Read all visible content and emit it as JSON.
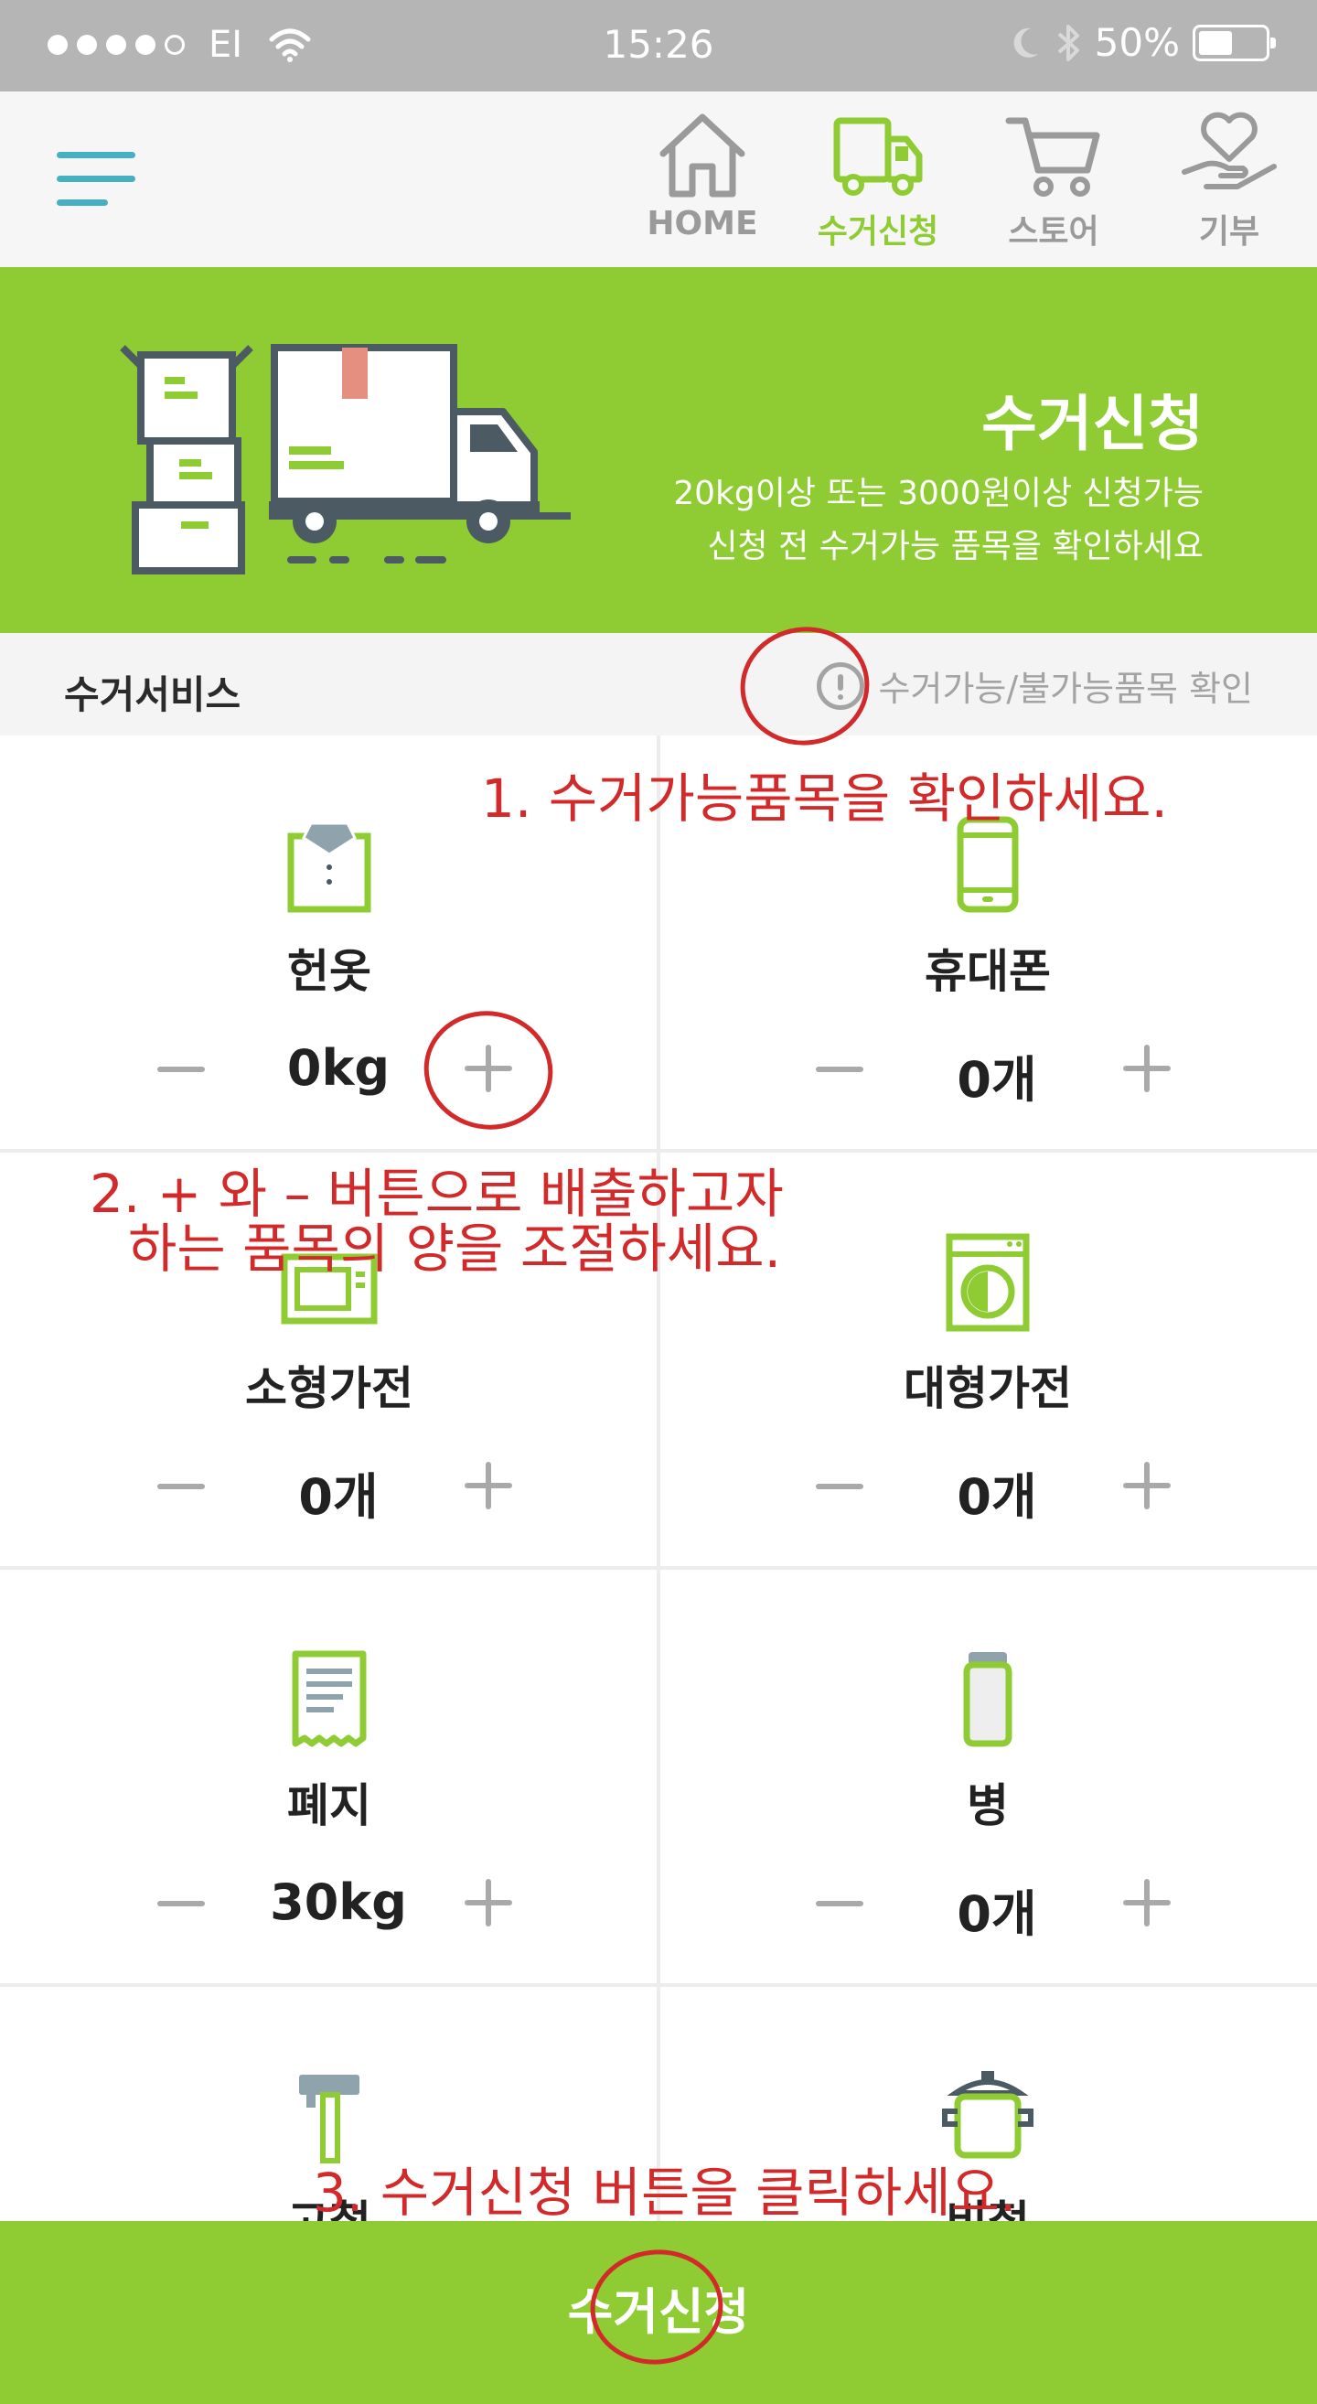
{
  "status_bar": {
    "carrier": "EI",
    "time": "15:26",
    "battery_percent": "50%",
    "battery_level": 0.5,
    "signal_icons": [
      "moon-icon",
      "bluetooth-icon"
    ]
  },
  "nav": {
    "menu_icon": "hamburger-icon",
    "tabs": [
      {
        "label": "HOME",
        "icon": "home-icon",
        "active": false
      },
      {
        "label": "수거신청",
        "icon": "truck-icon",
        "active": true
      },
      {
        "label": "스토어",
        "icon": "cart-icon",
        "active": false
      },
      {
        "label": "기부",
        "icon": "heart-hand-icon",
        "active": false
      }
    ]
  },
  "banner": {
    "title": "수거신청",
    "line1": "20kg이상 또는 3000원이상 신청가능",
    "line2": "신청 전 수거가능 품목을 확인하세요"
  },
  "service": {
    "title": "수거서비스",
    "check_link": "수거가능/불가능품목 확인"
  },
  "items": [
    {
      "name": "헌옷",
      "qty": "0kg",
      "icon": "shirt-icon"
    },
    {
      "name": "휴대폰",
      "qty": "0개",
      "icon": "phone-icon"
    },
    {
      "name": "소형가전",
      "qty": "0개",
      "icon": "microwave-icon"
    },
    {
      "name": "대형가전",
      "qty": "0개",
      "icon": "washer-icon"
    },
    {
      "name": "폐지",
      "qty": "30kg",
      "icon": "paper-icon"
    },
    {
      "name": "병",
      "qty": "0개",
      "icon": "bottle-icon"
    },
    {
      "name": "고철",
      "qty": "",
      "icon": "hammer-icon"
    },
    {
      "name": "비철",
      "qty": "",
      "icon": "pot-icon"
    }
  ],
  "submit_label": "수거신청",
  "annotations": {
    "step1": "1. 수거가능품목을 확인하세요.",
    "step2_line1": "2. + 와 – 버튼으로 배출하고자",
    "step2_line2": "하는 품목의 양을 조절하세요.",
    "step3": "3. 수거신청 버튼을 클릭하세요."
  },
  "colors": {
    "green": "#8fcc33",
    "teal": "#46b0c2",
    "annotation_red": "#d22a2a"
  }
}
